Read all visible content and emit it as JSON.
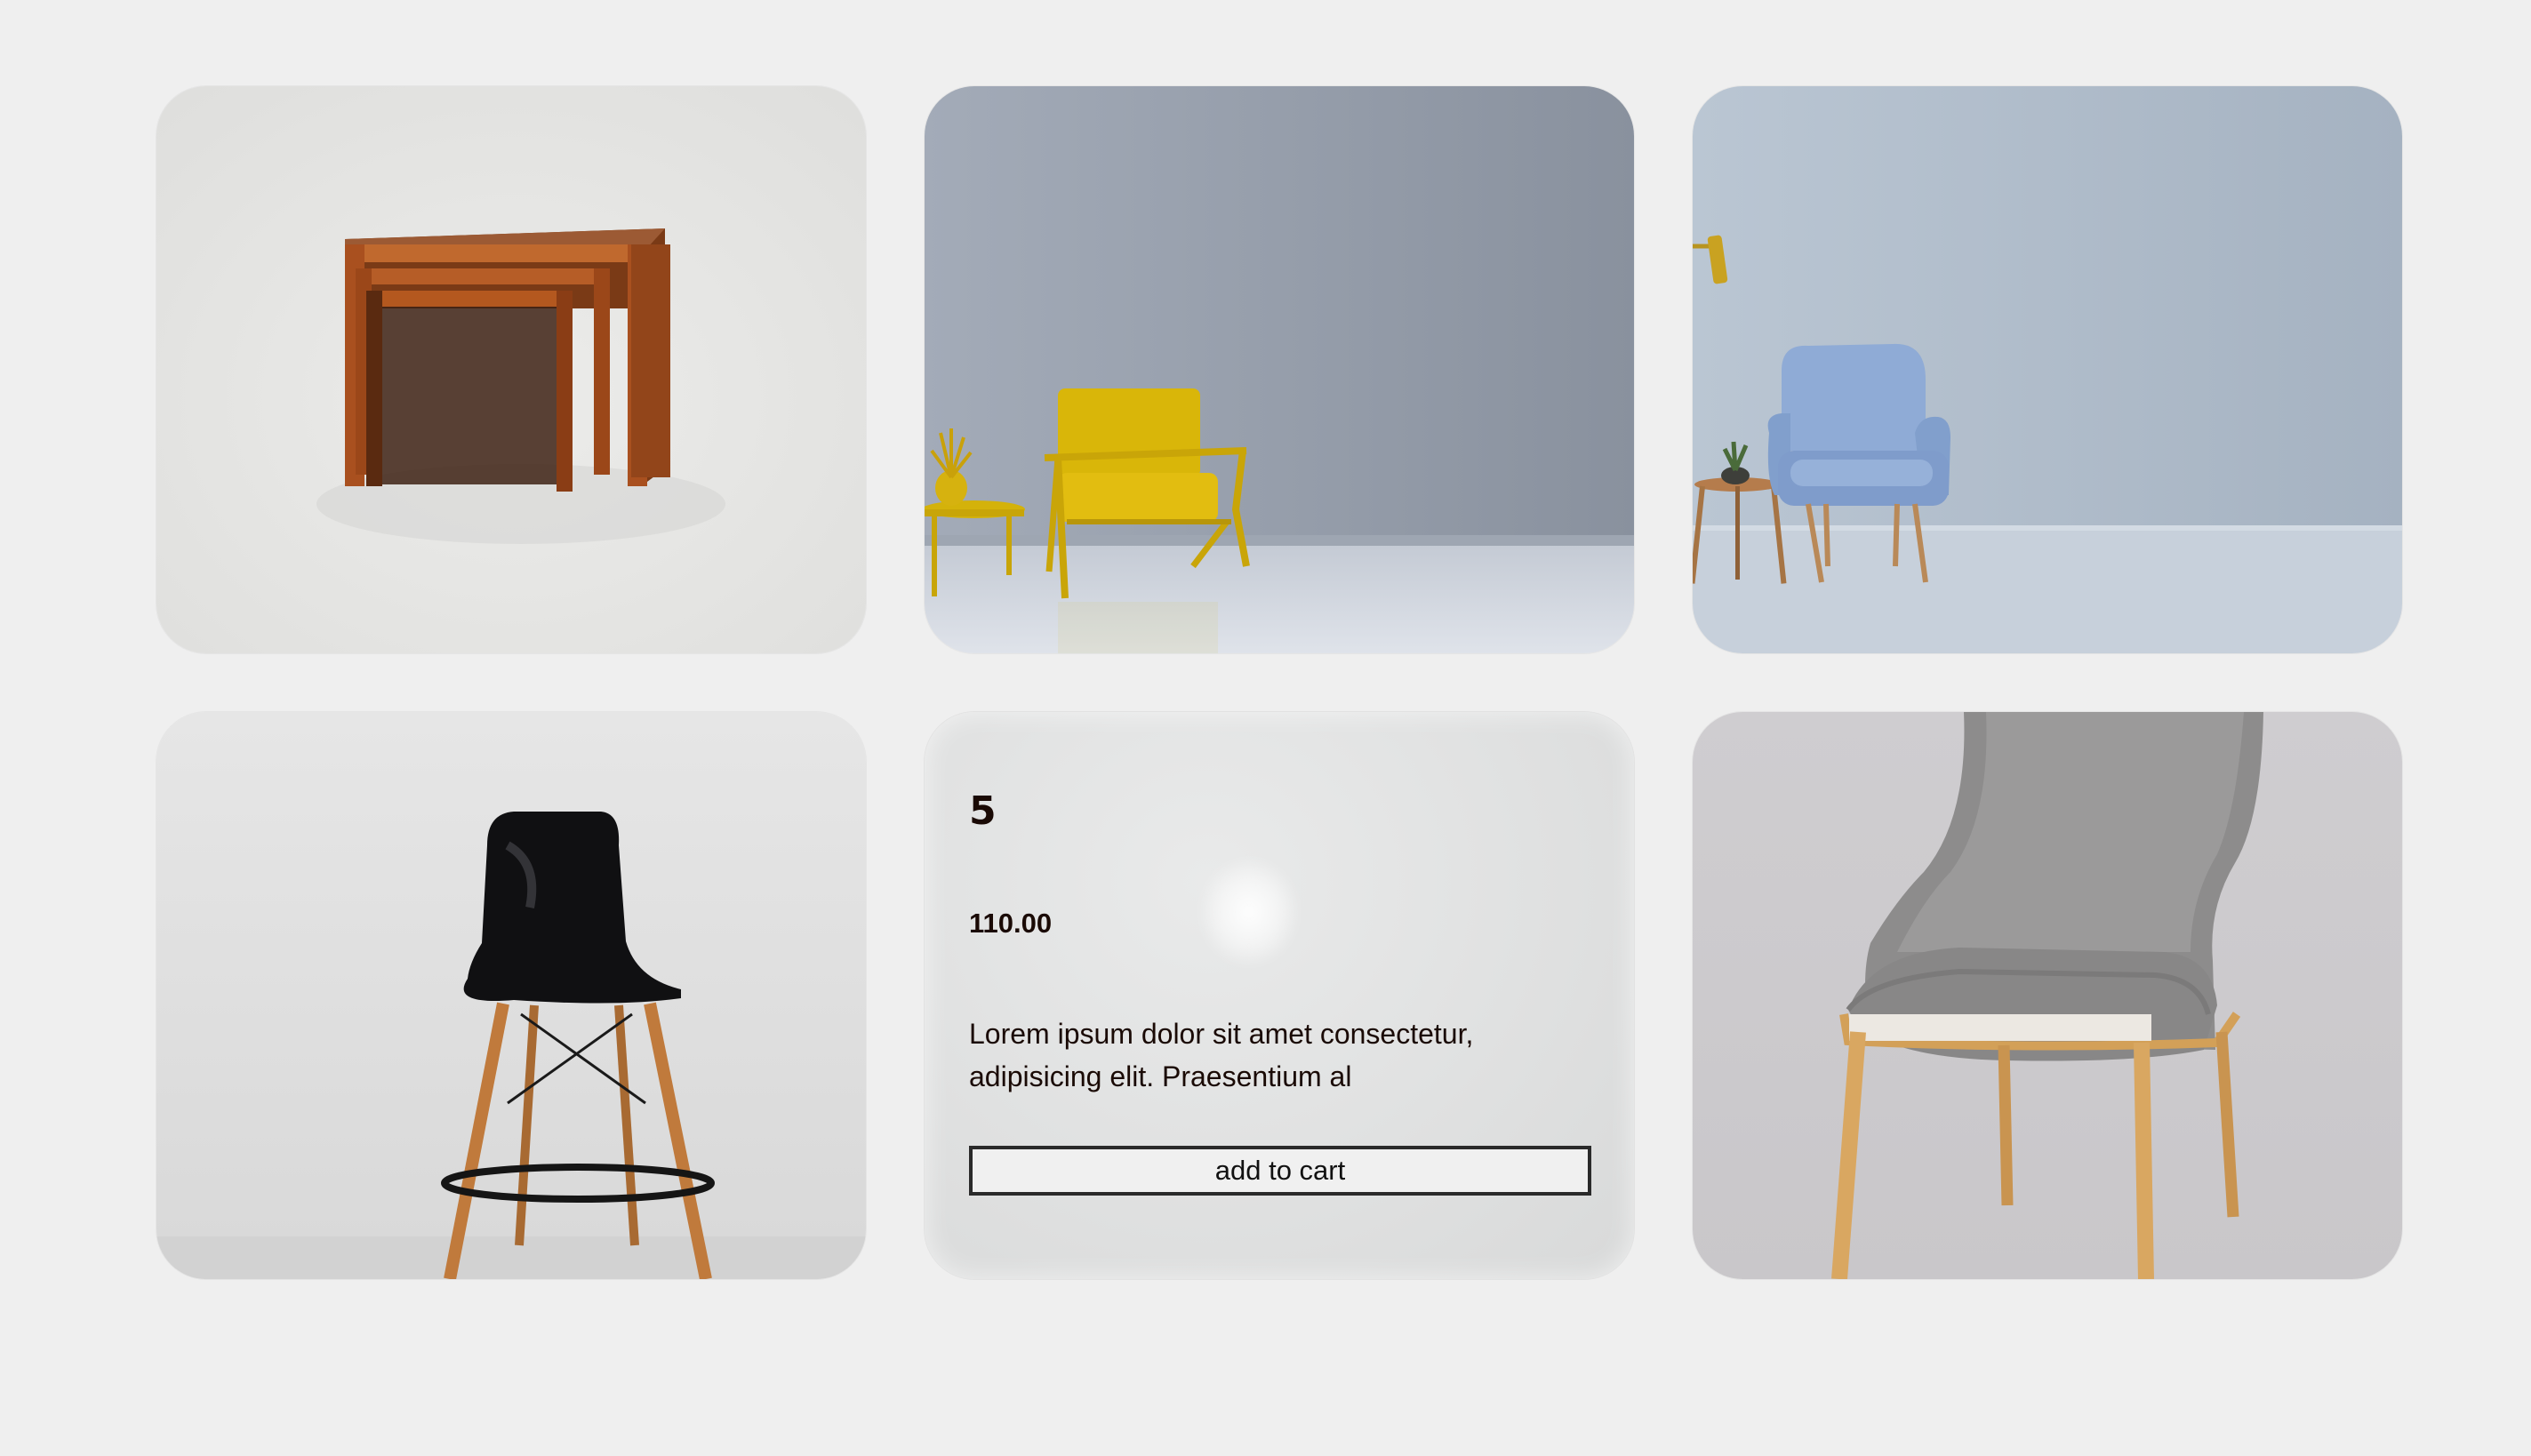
{
  "products": [
    {
      "image": "nesting-tables"
    },
    {
      "image": "yellow-armchair"
    },
    {
      "image": "blue-armchair"
    },
    {
      "image": "black-bar-stool"
    },
    {
      "title": "5",
      "price": "110.00",
      "description": "Lorem ipsum dolor sit amet consectetur, adipisicing elit. Praesentium al",
      "cta": "add to cart"
    },
    {
      "image": "gray-upholstered-chair"
    }
  ],
  "colors": {
    "background": "#efefef",
    "text": "#1a0a05"
  }
}
